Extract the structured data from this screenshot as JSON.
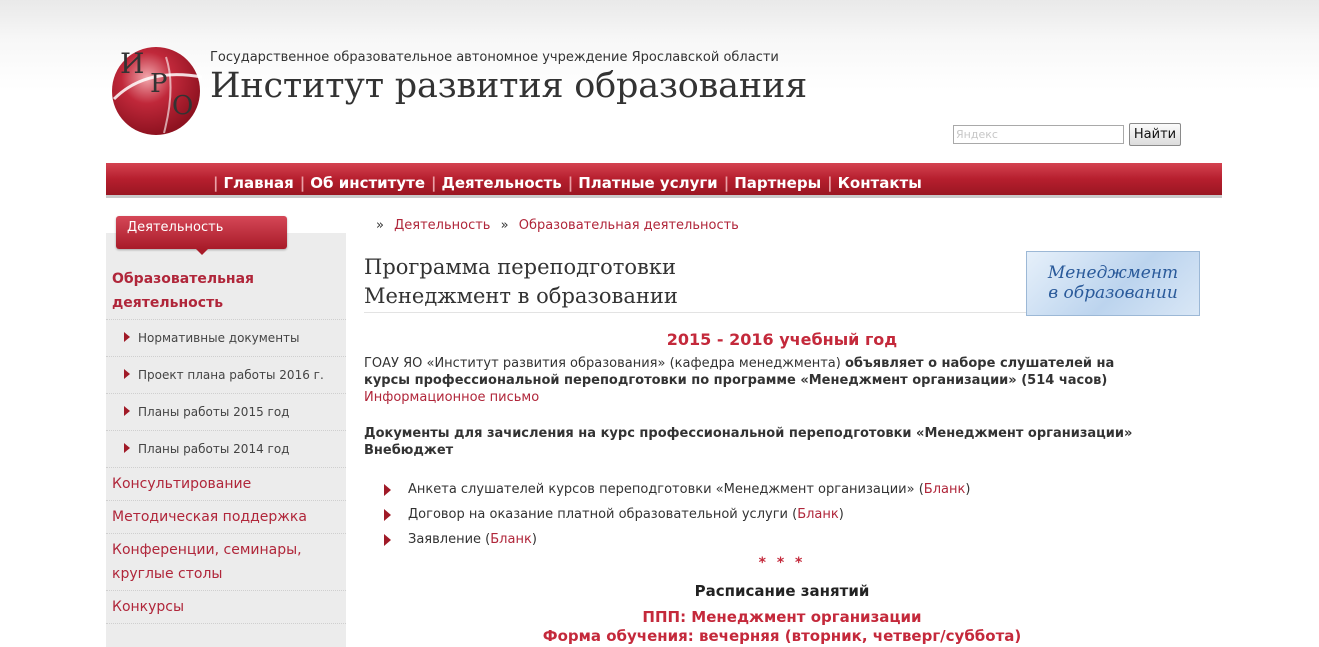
{
  "header": {
    "logo_letters": [
      "И",
      "Р",
      "О"
    ],
    "subtitle": "Государственное образовательное автономное учреждение Ярославской области",
    "title": "Институт развития образования"
  },
  "search": {
    "placeholder": "Яндекс",
    "button_label": "Найти"
  },
  "nav": {
    "items": [
      "Главная",
      "Об институте",
      "Деятельность",
      "Платные услуги",
      "Партнеры",
      "Контакты"
    ],
    "separator": "|"
  },
  "sidebar": {
    "tab_label": "Деятельность",
    "items": [
      {
        "label": "Образовательная деятельность",
        "kind": "main",
        "active": true
      },
      {
        "label": "Нормативные документы",
        "kind": "sub"
      },
      {
        "label": "Проект плана работы 2016 г.",
        "kind": "sub"
      },
      {
        "label": "Планы работы 2015 год",
        "kind": "sub"
      },
      {
        "label": "Планы работы 2014 год",
        "kind": "sub"
      },
      {
        "label": "Консультирование",
        "kind": "main"
      },
      {
        "label": "Методическая поддержка",
        "kind": "main"
      },
      {
        "label": "Конференции, семинары, круглые столы",
        "kind": "main"
      },
      {
        "label": "Конкурсы",
        "kind": "main"
      }
    ]
  },
  "breadcrumb": {
    "separator": "»",
    "items": [
      "Деятельность",
      "Образовательная деятельность"
    ]
  },
  "content": {
    "title_line1": "Программа переподготовки",
    "title_line2": "Менеджмент в образовании",
    "banner_line1": "Менеджмент",
    "banner_line2": "в образовании",
    "year": "2015 - 2016 учебный год",
    "intro_plain": "ГОАУ ЯО «Институт развития образования» (кафедра менеджмента)",
    "intro_bold": "объявляет о наборе слушателей на курсы профессиональной переподготовки по программе «Менеджмент организации» (514 часов)",
    "info_letter_link": "Информационное письмо",
    "docs_heading_line1": "Документы для зачисления на курс профессиональной переподготовки «Менеджмент организации»",
    "docs_heading_line2": "Внебюджет",
    "documents": [
      {
        "text": "Анкета слушателей курсов переподготовки «Менеджмент организации»",
        "link": "Бланк"
      },
      {
        "text": "Договор на оказание платной образовательной услуги",
        "link": "Бланк"
      },
      {
        "text": "Заявление",
        "link": "Бланк"
      }
    ],
    "stars": "* * *",
    "schedule_title": "Расписание занятий",
    "program_line": "ППП: Менеджмент организации",
    "form_line": "Форма обучения: вечерняя (вторник, четверг/суббота)"
  },
  "colors": {
    "brand_red": "#b61f2e",
    "link_red": "#b0263a",
    "accent_red": "#c4293b",
    "sidebar_bg": "#ececec"
  }
}
